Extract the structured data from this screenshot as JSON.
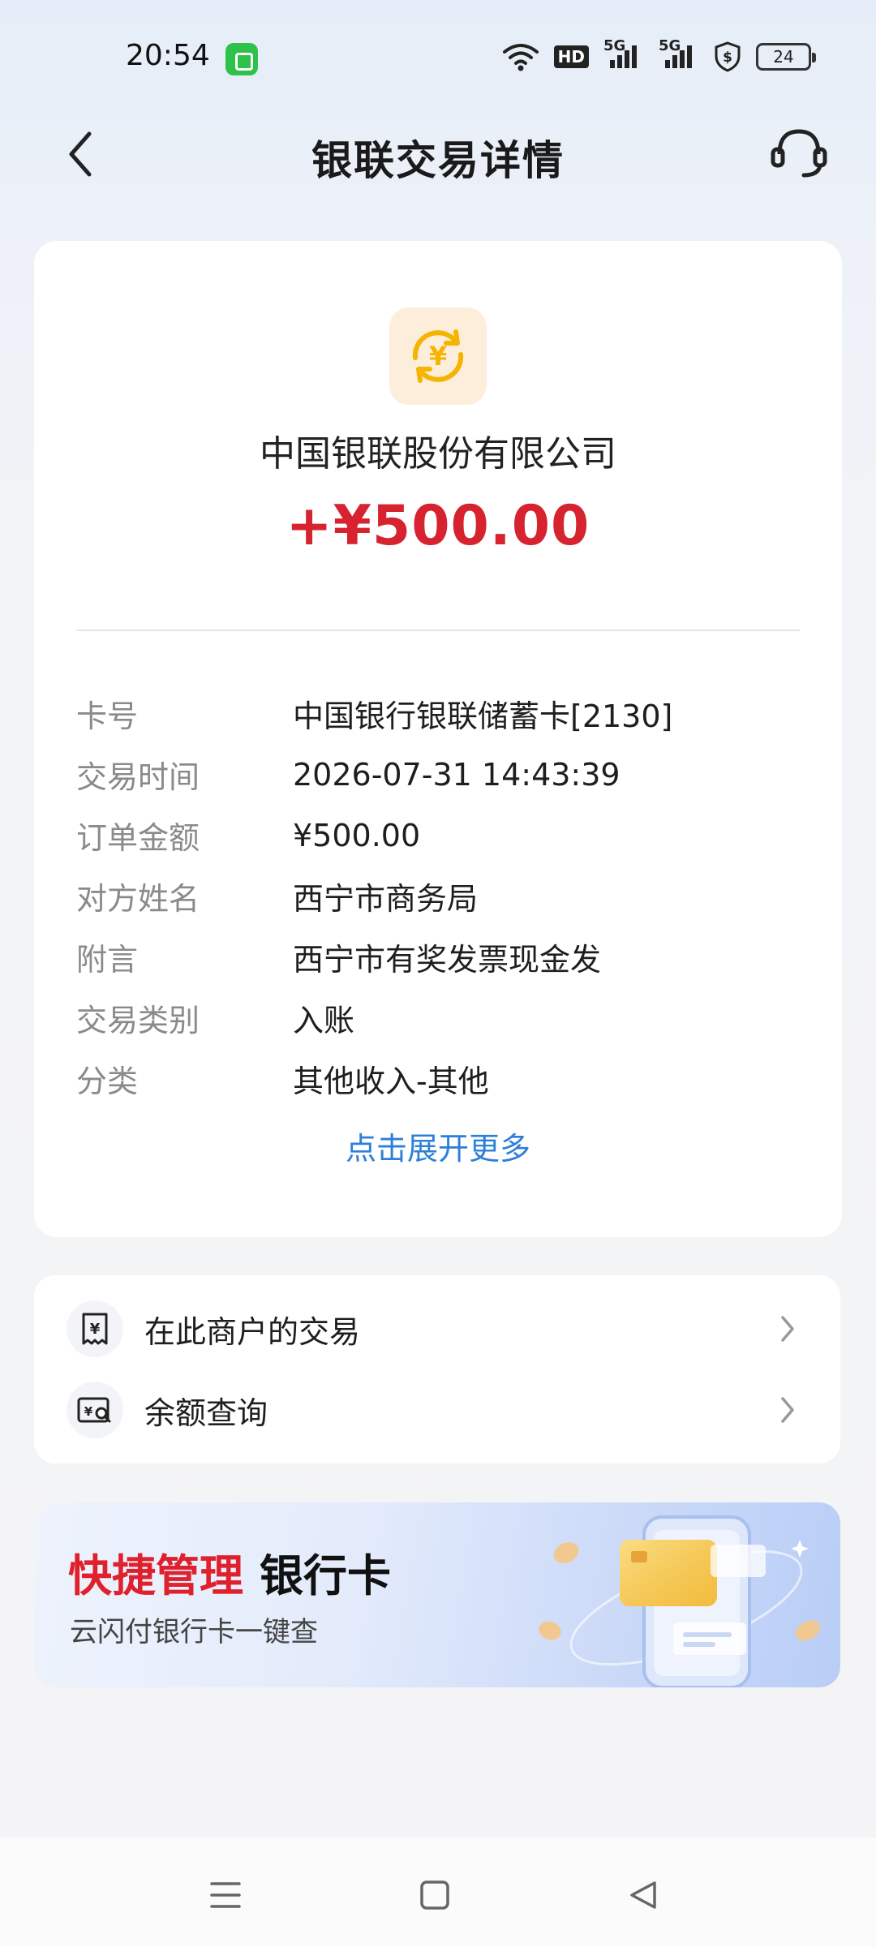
{
  "status_bar": {
    "time": "20:54",
    "hd_label": "HD",
    "signal_1_label": "5G",
    "signal_2_label": "5G",
    "battery": "24"
  },
  "header": {
    "title": "银联交易详情"
  },
  "transaction": {
    "merchant_name": "中国银联股份有限公司",
    "amount": "+¥500.00",
    "details": [
      {
        "label": "卡号",
        "value": "中国银行银联储蓄卡[2130]"
      },
      {
        "label": "交易时间",
        "value": "2026-07-31 14:43:39"
      },
      {
        "label": "订单金额",
        "value": "¥500.00"
      },
      {
        "label": "对方姓名",
        "value": "西宁市商务局"
      },
      {
        "label": "附言",
        "value": "西宁市有奖发票现金发"
      },
      {
        "label": "交易类别",
        "value": "入账"
      },
      {
        "label": "分类",
        "value": "其他收入-其他"
      }
    ],
    "expand_label": "点击展开更多"
  },
  "menu": {
    "items": [
      {
        "label": "在此商户的交易",
        "icon": "receipt-yen-icon"
      },
      {
        "label": "余额查询",
        "icon": "balance-search-icon"
      }
    ]
  },
  "banner": {
    "title_red": "快捷管理",
    "title_black": "银行卡",
    "subtitle": "云闪付银行卡一键查"
  },
  "colors": {
    "amount_red": "#d6232f",
    "link_blue": "#2d7fd8",
    "logo_yellow": "#f5b400"
  }
}
